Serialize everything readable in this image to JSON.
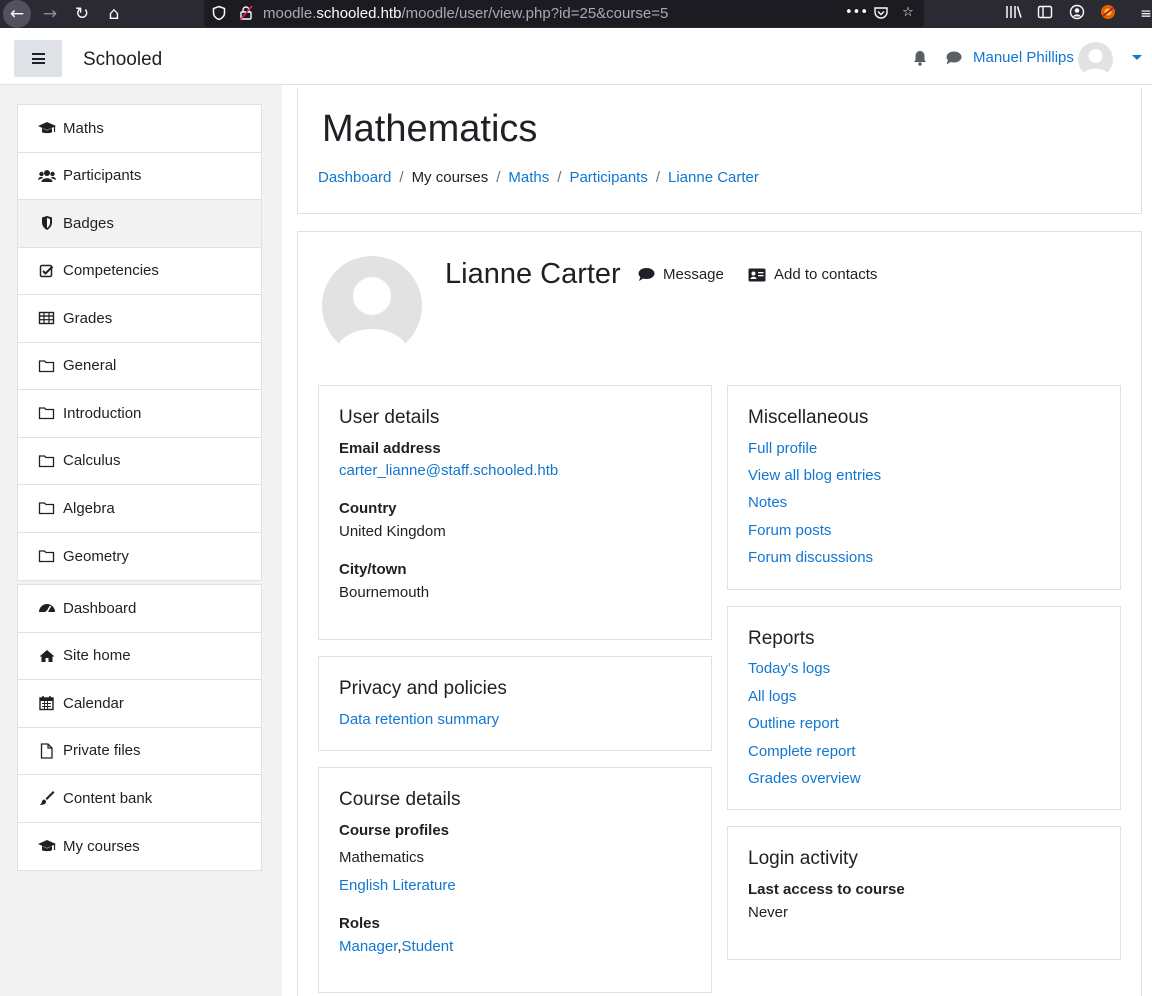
{
  "browser": {
    "url_prefix": "moodle.",
    "url_domain": "schooled.htb",
    "url_path": "/moodle/user/view.php?id=25&course=5"
  },
  "navbar": {
    "site_name": "Schooled",
    "user_name": "Manuel Phillips"
  },
  "course_nav": [
    {
      "label": "Maths",
      "icon": "graduation-cap-icon"
    },
    {
      "label": "Participants",
      "icon": "users-icon"
    },
    {
      "label": "Badges",
      "icon": "shield-icon"
    },
    {
      "label": "Competencies",
      "icon": "check-square-icon"
    },
    {
      "label": "Grades",
      "icon": "table-icon"
    },
    {
      "label": "General",
      "icon": "folder-icon"
    },
    {
      "label": "Introduction",
      "icon": "folder-icon"
    },
    {
      "label": "Calculus",
      "icon": "folder-icon"
    },
    {
      "label": "Algebra",
      "icon": "folder-icon"
    },
    {
      "label": "Geometry",
      "icon": "folder-icon"
    }
  ],
  "site_nav": [
    {
      "label": "Dashboard",
      "icon": "dashboard-icon"
    },
    {
      "label": "Site home",
      "icon": "home-icon"
    },
    {
      "label": "Calendar",
      "icon": "calendar-icon"
    },
    {
      "label": "Private files",
      "icon": "file-icon"
    },
    {
      "label": "Content bank",
      "icon": "paintbrush-icon"
    },
    {
      "label": "My courses",
      "icon": "graduation-cap-icon"
    }
  ],
  "page": {
    "heading": "Mathematics",
    "breadcrumb": [
      "Dashboard",
      "My courses",
      "Maths",
      "Participants",
      "Lianne Carter"
    ]
  },
  "profile": {
    "name": "Lianne Carter",
    "message_label": "Message",
    "add_contact_label": "Add to contacts"
  },
  "user_details": {
    "title": "User details",
    "email_label": "Email address",
    "email": "carter_lianne@staff.schooled.htb",
    "country_label": "Country",
    "country": "United Kingdom",
    "city_label": "City/town",
    "city": "Bournemouth"
  },
  "privacy": {
    "title": "Privacy and policies",
    "link": "Data retention summary"
  },
  "course_details": {
    "title": "Course details",
    "profiles_label": "Course profiles",
    "current_course": "Mathematics",
    "other_course": "English Literature",
    "roles_label": "Roles",
    "role_1": "Manager",
    "role_sep": ",",
    "role_2": "Student"
  },
  "misc": {
    "title": "Miscellaneous",
    "links": [
      "Full profile",
      "View all blog entries",
      "Notes",
      "Forum posts",
      "Forum discussions"
    ]
  },
  "reports": {
    "title": "Reports",
    "links": [
      "Today's logs",
      "All logs",
      "Outline report",
      "Complete report",
      "Grades overview"
    ]
  },
  "login_activity": {
    "title": "Login activity",
    "label": "Last access to course",
    "value": "Never"
  }
}
